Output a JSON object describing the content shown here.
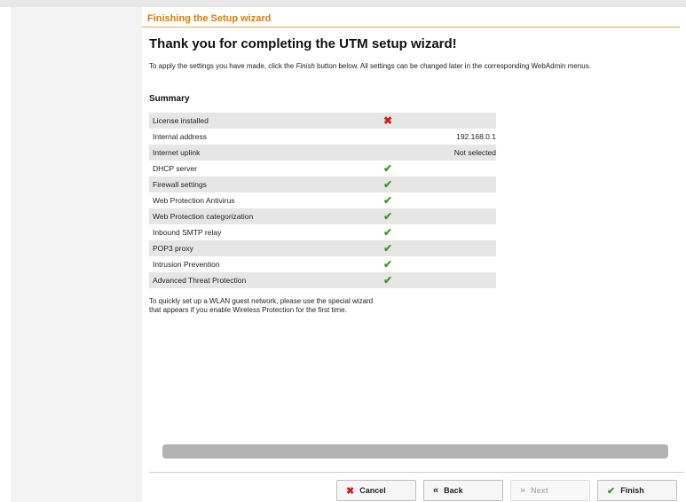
{
  "header": {
    "title": "Finishing the Setup wizard"
  },
  "page": {
    "heading": "Thank you for completing the UTM setup wizard!",
    "intro_before": "To apply the settings you have made, click the ",
    "intro_emph": "Finish",
    "intro_after": " button below. All settings can be changed later in the corresponding WebAdmin menus."
  },
  "summary": {
    "title": "Summary",
    "rows": [
      {
        "label": "License installed",
        "status": "✖",
        "value": ""
      },
      {
        "label": "Internal address",
        "status": "",
        "value": "192.168.0.1"
      },
      {
        "label": "Internet uplink",
        "status": "",
        "value": "Not selected"
      },
      {
        "label": "DHCP server",
        "status": "✔",
        "value": ""
      },
      {
        "label": "Firewall settings",
        "status": "✔",
        "value": ""
      },
      {
        "label": "Web Protection Antivirus",
        "status": "✔",
        "value": ""
      },
      {
        "label": "Web Protection categorization",
        "status": "✔",
        "value": ""
      },
      {
        "label": "Inbound SMTP relay",
        "status": "✔",
        "value": ""
      },
      {
        "label": "POP3 proxy",
        "status": "✔",
        "value": ""
      },
      {
        "label": "Intrusion Prevention",
        "status": "✔",
        "value": ""
      },
      {
        "label": "Advanced Threat Protection",
        "status": "✔",
        "value": ""
      }
    ]
  },
  "note": {
    "line1": "To quickly set up a WLAN guest network, please use the special wizard",
    "line2": "that appears if you enable Wireless Protection for the first time."
  },
  "buttons": {
    "cancel": {
      "label": "Cancel",
      "icon": "✖"
    },
    "back": {
      "label": "Back",
      "icon": "«"
    },
    "next": {
      "label": "Next",
      "icon": "»"
    },
    "finish": {
      "label": "Finish",
      "icon": "✔"
    }
  },
  "colors": {
    "accent": "#e07b00",
    "check": "#3d9a2b",
    "cross": "#d02020"
  }
}
